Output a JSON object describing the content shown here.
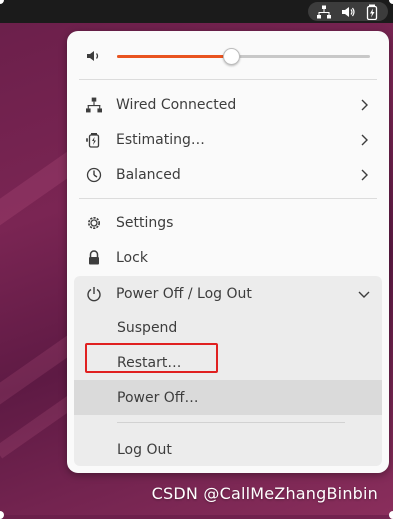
{
  "topbar": {
    "icons": [
      "network-wired-icon",
      "volume-icon",
      "battery-charging-icon"
    ]
  },
  "panel": {
    "volume": {
      "icon": "volume-icon",
      "level": 0.45
    },
    "items": [
      {
        "icon": "network-wired-icon",
        "label": "Wired Connected",
        "has_submenu": true
      },
      {
        "icon": "battery-icon",
        "label": "Estimating…",
        "has_submenu": true
      },
      {
        "icon": "power-mode-icon",
        "label": "Balanced",
        "has_submenu": true
      }
    ],
    "settings": {
      "icon": "gear-icon",
      "label": "Settings"
    },
    "lock": {
      "icon": "lock-icon",
      "label": "Lock"
    },
    "power": {
      "icon": "power-icon",
      "label": "Power Off / Log Out",
      "expanded": true,
      "submenu": [
        {
          "label": "Suspend"
        },
        {
          "label": "Restart…",
          "highlighted": true
        },
        {
          "label": "Power Off…",
          "hovered": true
        },
        {
          "label": "Log Out"
        }
      ]
    }
  },
  "colors": {
    "accent": "#e95420",
    "panel_bg": "#fafafa",
    "highlight_border": "#e02020"
  },
  "watermark": "CSDN @CallMeZhangBinbin"
}
